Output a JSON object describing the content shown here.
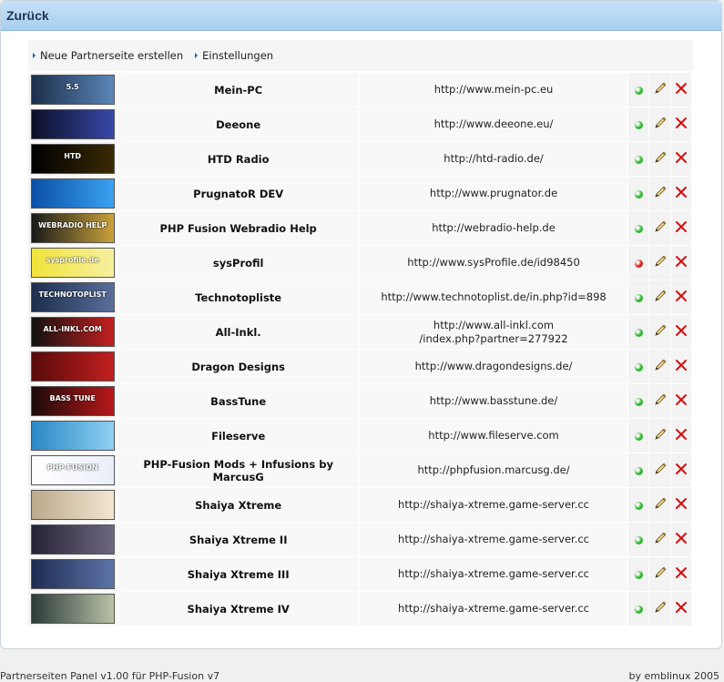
{
  "header": {
    "title": "Zurück"
  },
  "toolbar": {
    "links": [
      {
        "label": "Neue Partnerseite erstellen"
      },
      {
        "label": "Einstellungen"
      }
    ]
  },
  "partners": [
    {
      "name": "Mein-PC",
      "url": "http://www.mein-pc.eu",
      "status": "active",
      "logo_colors": [
        "#1c2f4a",
        "#5b86b9"
      ],
      "logo_text": "5.5"
    },
    {
      "name": "Deeone",
      "url": "http://www.deeone.eu/",
      "status": "active",
      "logo_colors": [
        "#0b0f26",
        "#3748a8"
      ],
      "logo_text": ""
    },
    {
      "name": "HTD Radio",
      "url": "http://htd-radio.de/",
      "status": "active",
      "logo_colors": [
        "#000000",
        "#3a2a05"
      ],
      "logo_text": "HTD"
    },
    {
      "name": "PrugnatoR DEV",
      "url": "http://www.prugnator.de",
      "status": "active",
      "logo_colors": [
        "#0b4fa8",
        "#3aa2f0"
      ],
      "logo_text": ""
    },
    {
      "name": "PHP Fusion Webradio Help",
      "url": "http://webradio-help.de",
      "status": "active",
      "logo_colors": [
        "#1a1a1a",
        "#c9a23a"
      ],
      "logo_text": "WEBRADIO HELP"
    },
    {
      "name": "sysProfil",
      "url": "http://www.sysProfile.de/id98450",
      "status": "inactive",
      "logo_colors": [
        "#f1e33a",
        "#f6f0a0"
      ],
      "logo_text": "sysprofile.de"
    },
    {
      "name": "Technotopliste",
      "url": "http://www.technotoplist.de/in.php?id=898",
      "status": "active",
      "logo_colors": [
        "#1d2e4e",
        "#586e9a"
      ],
      "logo_text": "TECHNOTOPLIST"
    },
    {
      "name": "All-Inkl.",
      "url": "http://www.all-inkl.com\n/index.php?partner=277922",
      "status": "active",
      "logo_colors": [
        "#111111",
        "#c32020"
      ],
      "logo_text": "ALL-INKL.COM"
    },
    {
      "name": "Dragon Designs",
      "url": "http://www.dragondesigns.de/",
      "status": "active",
      "logo_colors": [
        "#5a0a0a",
        "#c21f1f"
      ],
      "logo_text": ""
    },
    {
      "name": "BassTune",
      "url": "http://www.basstune.de/",
      "status": "active",
      "logo_colors": [
        "#1b0a0a",
        "#b8181a"
      ],
      "logo_text": "BASS TUNE"
    },
    {
      "name": "Fileserve",
      "url": "http://www.fileserve.com",
      "status": "active",
      "logo_colors": [
        "#2a88c4",
        "#8fd0f3"
      ],
      "logo_text": ""
    },
    {
      "name": "PHP-Fusion Mods + Infusions by MarcusG",
      "url": "http://phpfusion.marcusg.de/",
      "status": "active",
      "logo_colors": [
        "#ffffff",
        "#e9eef8"
      ],
      "logo_text": "PHP-FUSION"
    },
    {
      "name": "Shaiya Xtreme",
      "url": "http://shaiya-xtreme.game-server.cc",
      "status": "active",
      "logo_colors": [
        "#bda98c",
        "#f2e6d0"
      ],
      "logo_text": ""
    },
    {
      "name": "Shaiya Xtreme II",
      "url": "http://shaiya-xtreme.game-server.cc",
      "status": "active",
      "logo_colors": [
        "#262236",
        "#6e6880"
      ],
      "logo_text": ""
    },
    {
      "name": "Shaiya Xtreme III",
      "url": "http://shaiya-xtreme.game-server.cc",
      "status": "active",
      "logo_colors": [
        "#1e2c52",
        "#5d74a8"
      ],
      "logo_text": ""
    },
    {
      "name": "Shaiya Xtreme IV",
      "url": "http://shaiya-xtreme.game-server.cc",
      "status": "active",
      "logo_colors": [
        "#2c3a3a",
        "#b9c2a6"
      ],
      "logo_text": ""
    }
  ],
  "colors": {
    "status_active": "#2fb82f",
    "status_inactive": "#d02020",
    "delete": "#d21010",
    "header_bg": "#b9dbf6"
  },
  "footer": {
    "left": "Partnerseiten Panel v1.00 für PHP-Fusion v7",
    "right": "by emblinux 2005"
  }
}
